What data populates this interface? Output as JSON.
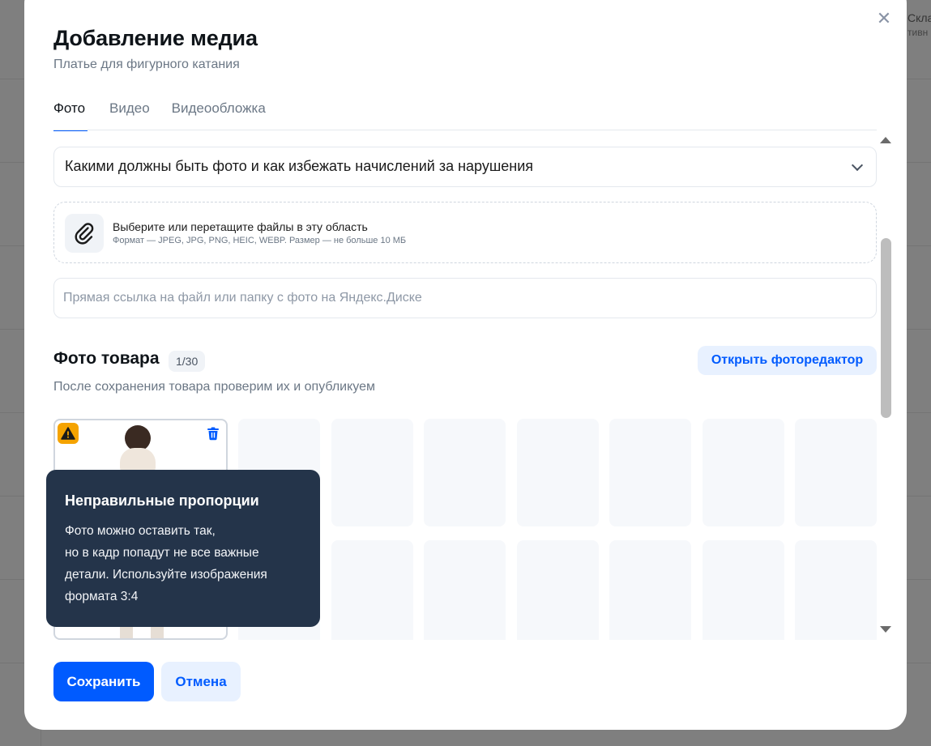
{
  "background": {
    "text_line1": "Скла",
    "text_line2": "тивн"
  },
  "modal": {
    "title": "Добавление медиа",
    "subtitle": "Платье для фигурного катания",
    "close_glyph": "✕",
    "tabs": [
      {
        "label": "Фото",
        "active": true
      },
      {
        "label": "Видео",
        "active": false
      },
      {
        "label": "Видеообложка",
        "active": false
      }
    ]
  },
  "accordion": {
    "label": "Какими должны быть фото и как избежать начислений за нарушения"
  },
  "dropzone": {
    "title": "Выберите или перетащите файлы в эту область",
    "subtitle": "Формат — JPEG, JPG, PNG, HEIC, WEBP. Размер — не больше 10 МБ"
  },
  "link_input": {
    "placeholder": "Прямая ссылка на файл или папку с фото на Яндекс.Диске",
    "value": ""
  },
  "photos_section": {
    "title": "Фото товара",
    "count": "1/30",
    "editor_button": "Открыть фоторедактор",
    "subtitle": "После сохранения товара проверим их и опубликуем"
  },
  "tooltip": {
    "title": "Неправильные пропорции",
    "lines": [
      "Фото можно оставить так,",
      "но в кадр попадут не все важные",
      "детали. Используйте изображения",
      "формата 3:4"
    ]
  },
  "footer": {
    "save_label": "Сохранить",
    "cancel_label": "Отмена"
  },
  "colors": {
    "accent": "#005bff",
    "warning": "#f5a300",
    "tooltip_bg": "#24344a"
  }
}
